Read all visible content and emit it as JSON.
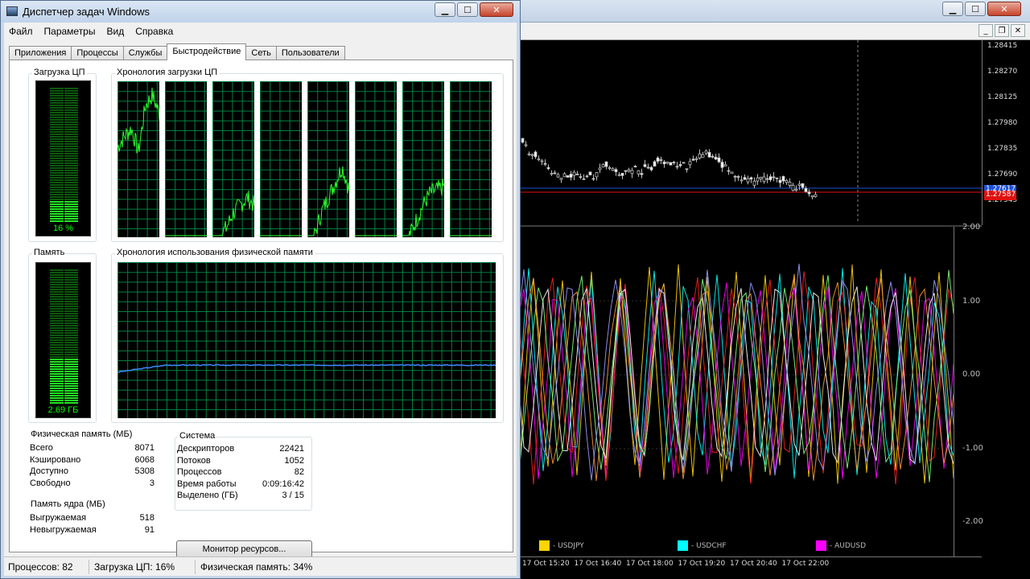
{
  "task_manager": {
    "title": "Диспетчер задач Windows",
    "menu": [
      "Файл",
      "Параметры",
      "Вид",
      "Справка"
    ],
    "tabs": [
      "Приложения",
      "Процессы",
      "Службы",
      "Быстродействие",
      "Сеть",
      "Пользователи"
    ],
    "active_tab": "Быстродействие",
    "cpu_usage": {
      "label": "Загрузка ЦП",
      "value_text": "16 %",
      "fraction": 0.16
    },
    "cpu_history": {
      "label": "Хронология загрузки ЦП",
      "core_count": 8
    },
    "memory": {
      "label": "Память",
      "value_text": "2.69 ГБ",
      "fraction": 0.34
    },
    "memory_history": {
      "label": "Хронология использования физической памяти"
    },
    "physical_memory": {
      "label": "Физическая память (МБ)",
      "rows": [
        {
          "name": "Всего",
          "value": "8071"
        },
        {
          "name": "Кэшировано",
          "value": "6068"
        },
        {
          "name": "Доступно",
          "value": "5308"
        },
        {
          "name": "Свободно",
          "value": "3"
        }
      ]
    },
    "kernel_memory": {
      "label": "Память ядра (МБ)",
      "rows": [
        {
          "name": "Выгружаемая",
          "value": "518"
        },
        {
          "name": "Невыгружаемая",
          "value": "91"
        }
      ]
    },
    "system": {
      "label": "Система",
      "rows": [
        {
          "name": "Дескрипторов",
          "value": "22421"
        },
        {
          "name": "Потоков",
          "value": "1052"
        },
        {
          "name": "Процессов",
          "value": "82"
        },
        {
          "name": "Время работы",
          "value": "0:09:16:42"
        },
        {
          "name": "Выделено (ГБ)",
          "value": "3 / 15"
        }
      ]
    },
    "resource_monitor_button": "Монитор ресурсов...",
    "status_bar": {
      "processes": "Процессов: 82",
      "cpu": "Загрузка ЦП: 16%",
      "memory": "Физическая память: 34%"
    },
    "window_buttons": {
      "minimize": "▁",
      "maximize": "☐",
      "close": "✕"
    }
  },
  "terminal": {
    "price_ticks": [
      "1.28415",
      "1.28270",
      "1.28125",
      "1.27980",
      "1.27835",
      "1.27690",
      "1.27545"
    ],
    "price_markers": [
      {
        "text": "1.27617",
        "color": "#1e50d8"
      },
      {
        "text": "1.27587",
        "color": "#e01010"
      }
    ],
    "osc_ticks": [
      "2.00",
      "1.00",
      "0.00",
      "-1.00",
      "-2.00"
    ],
    "legend": [
      {
        "label": "- USDJPY",
        "color": "#ffd400"
      },
      {
        "label": "- USDCHF",
        "color": "#00ffff"
      },
      {
        "label": "- AUDUSD",
        "color": "#ff00ff"
      }
    ],
    "time_ticks": [
      "17 Oct 15:20",
      "17 Oct 16:40",
      "17 Oct 18:00",
      "17 Oct 19:20",
      "17 Oct 20:40",
      "17 Oct 22:00"
    ]
  }
}
